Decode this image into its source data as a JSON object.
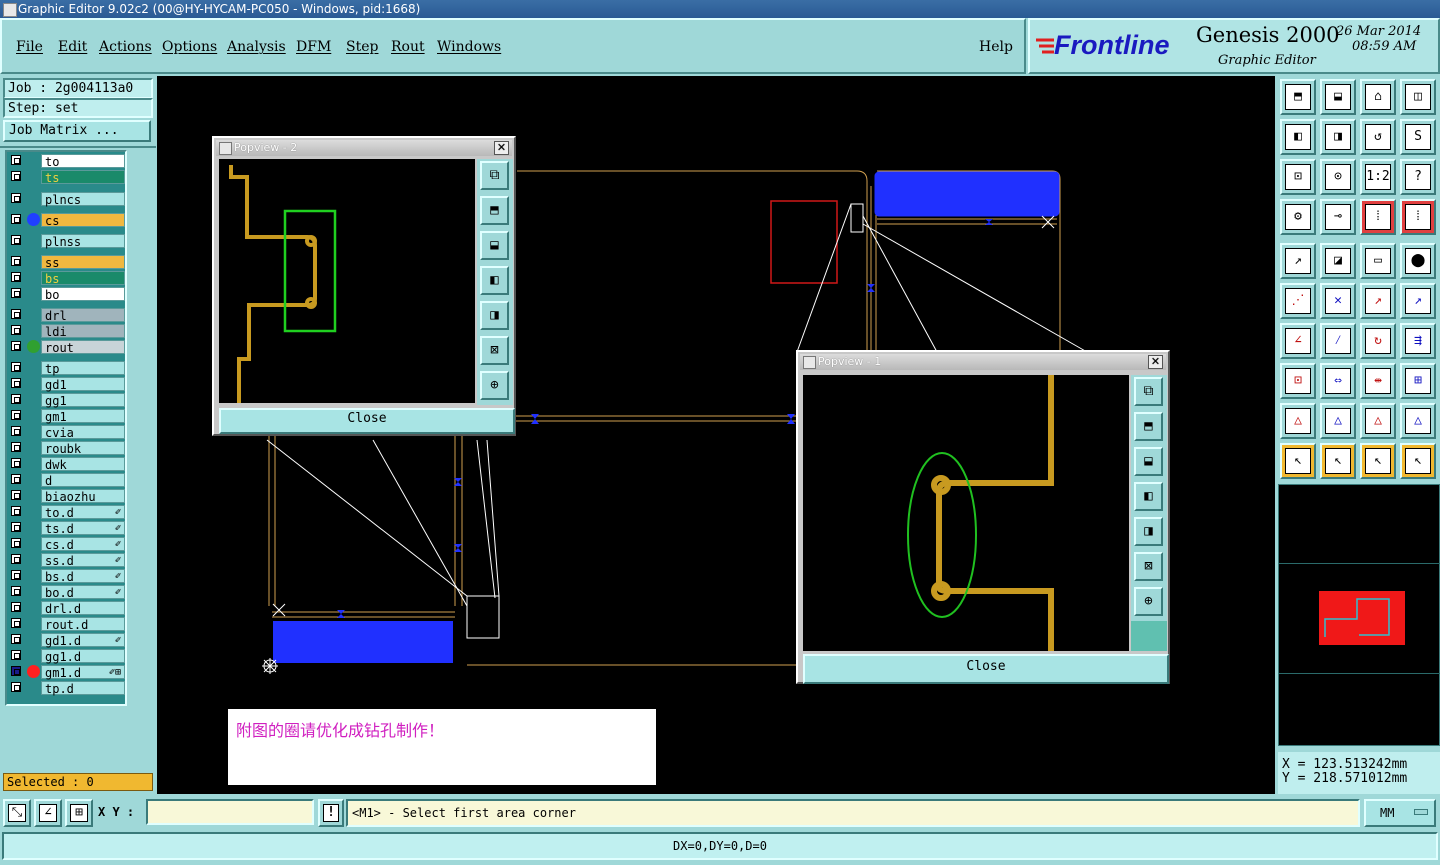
{
  "window": {
    "title": "Graphic Editor 9.02c2 (00@HY-HYCAM-PC050 - Windows, pid:1668)"
  },
  "menu": {
    "items": [
      "File",
      "Edit",
      "Actions",
      "Options",
      "Analysis",
      "DFM",
      "Step",
      "Rout",
      "Windows"
    ],
    "help": "Help"
  },
  "brand": {
    "logo": "Frontline",
    "product": "Genesis 2000",
    "subtitle": "Graphic Editor",
    "date": "26 Mar 2014",
    "time": "08:59 AM"
  },
  "job": {
    "job_line": "Job : 2g004113a0",
    "step_line": "Step: set",
    "matrix_button": "Job Matrix ..."
  },
  "layers": [
    {
      "name": "to",
      "color": "#ffffff",
      "dot": ""
    },
    {
      "name": "ts",
      "color": "#1a8a6a",
      "dot": ""
    },
    {
      "name": "plncs",
      "color": "#a8e4e4",
      "dot": ""
    },
    {
      "name": "cs",
      "color": "#f0b840",
      "dot": "#2040ff"
    },
    {
      "name": "plnss",
      "color": "#a8e4e4",
      "dot": ""
    },
    {
      "name": "ss",
      "color": "#f0b840",
      "dot": ""
    },
    {
      "name": "bs",
      "color": "#1a8a6a",
      "dot": ""
    },
    {
      "name": "bo",
      "color": "#ffffff",
      "dot": ""
    },
    {
      "name": "drl",
      "color": "#a0b4bc",
      "dot": ""
    },
    {
      "name": "ldi",
      "color": "#a0b4bc",
      "dot": ""
    },
    {
      "name": "rout",
      "color": "#c8d4d8",
      "dot": "#30a030"
    },
    {
      "name": "tp",
      "color": "#a8e4e4",
      "dot": ""
    },
    {
      "name": "gd1",
      "color": "#a8e4e4",
      "dot": ""
    },
    {
      "name": "gg1",
      "color": "#a8e4e4",
      "dot": ""
    },
    {
      "name": "gm1",
      "color": "#a8e4e4",
      "dot": ""
    },
    {
      "name": "cvia",
      "color": "#a8e4e4",
      "dot": ""
    },
    {
      "name": "roubk",
      "color": "#a8e4e4",
      "dot": ""
    },
    {
      "name": "dwk",
      "color": "#a8e4e4",
      "dot": ""
    },
    {
      "name": "d",
      "color": "#a8e4e4",
      "dot": ""
    },
    {
      "name": "biaozhu",
      "color": "#a8e4e4",
      "dot": ""
    },
    {
      "name": "to.d",
      "color": "#a8e4e4",
      "dot": "",
      "lock": "✐"
    },
    {
      "name": "ts.d",
      "color": "#a8e4e4",
      "dot": "",
      "lock": "✐"
    },
    {
      "name": "cs.d",
      "color": "#a8e4e4",
      "dot": "",
      "lock": "✐"
    },
    {
      "name": "ss.d",
      "color": "#a8e4e4",
      "dot": "",
      "lock": "✐"
    },
    {
      "name": "bs.d",
      "color": "#a8e4e4",
      "dot": "",
      "lock": "✐"
    },
    {
      "name": "bo.d",
      "color": "#a8e4e4",
      "dot": "",
      "lock": "✐"
    },
    {
      "name": "drl.d",
      "color": "#a8e4e4",
      "dot": ""
    },
    {
      "name": "rout.d",
      "color": "#a8e4e4",
      "dot": ""
    },
    {
      "name": "gd1.d",
      "color": "#a8e4e4",
      "dot": "",
      "lock": "✐"
    },
    {
      "name": "gg1.d",
      "color": "#a8e4e4",
      "dot": ""
    },
    {
      "name": "gm1.d",
      "color": "#a8e4e4",
      "dot": "#ff2020",
      "lock": "✐⊞"
    },
    {
      "name": "tp.d",
      "color": "#a8e4e4",
      "dot": ""
    }
  ],
  "selected": "Selected : 0",
  "popview2": {
    "title": "Popview - 2",
    "close": "Close"
  },
  "popview1": {
    "title": "Popview - 1",
    "close": "Close"
  },
  "note": "附图的圈请优化成钻孔制作！",
  "toolbox": {
    "row1": [
      "⬒",
      "⬓",
      "⌂",
      "◫"
    ],
    "row2": [
      "◧",
      "◨",
      "↺",
      "S"
    ],
    "row3": [
      "⊡",
      "⊙",
      "1:2",
      "?"
    ],
    "row4": [
      "⚙",
      "⊸",
      "⁞",
      "⁞"
    ],
    "row5": [
      "↗",
      "◪",
      "▭",
      "⬤"
    ],
    "row6": [
      "⋰",
      "✕",
      "↗",
      "↗"
    ],
    "row7": [
      "∠",
      "⁄",
      "↻",
      "⇶"
    ],
    "row8": [
      "⊡",
      "⇔",
      "⇹",
      "⊞"
    ],
    "row9": [
      "△",
      "△",
      "△",
      "△"
    ],
    "row10": [
      "↖",
      "↖",
      "↖",
      "↖"
    ]
  },
  "coords": {
    "x": "X  =  123.513242mm",
    "y": "Y  =  218.571012mm"
  },
  "statusbar": {
    "xy_label": "X Y :",
    "xy_value": "",
    "message": "<M1> - Select first area corner",
    "units": "MM",
    "delta": "DX=0,DY=0,D=0"
  },
  "colors": {
    "panel": "#9fd8d8",
    "pad_blue": "#2030ff",
    "copper": "#c89a20",
    "outline": "#d0a050"
  }
}
